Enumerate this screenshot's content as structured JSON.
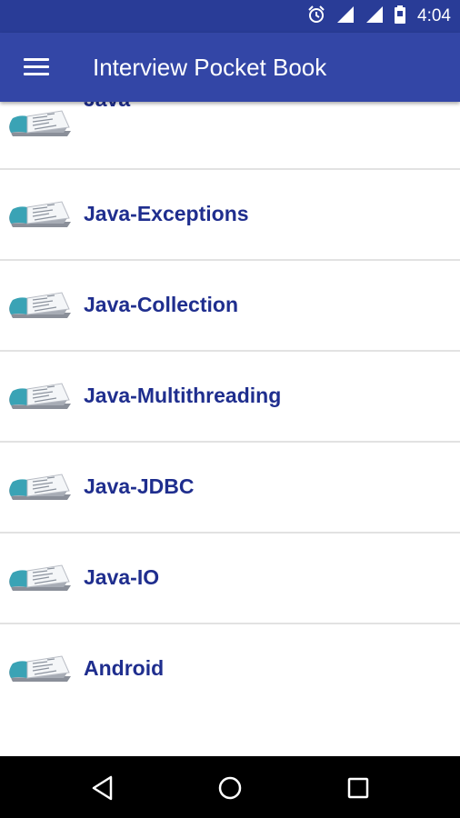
{
  "status_bar": {
    "time": "4:04",
    "icons": [
      "alarm-icon",
      "signal-icon",
      "signal-icon",
      "battery-icon"
    ]
  },
  "app_bar": {
    "menu_icon": "hamburger-menu-icon",
    "title": "Interview Pocket Book",
    "background": "#3346a6"
  },
  "topics": [
    {
      "label": "Java",
      "icon": "book-icon"
    },
    {
      "label": "Java-Exceptions",
      "icon": "book-icon"
    },
    {
      "label": "Java-Collection",
      "icon": "book-icon"
    },
    {
      "label": "Java-Multithreading",
      "icon": "book-icon"
    },
    {
      "label": "Java-JDBC",
      "icon": "book-icon"
    },
    {
      "label": "Java-IO",
      "icon": "book-icon"
    },
    {
      "label": "Android",
      "icon": "book-icon"
    }
  ],
  "navigation_bar": {
    "buttons": [
      "back-icon",
      "home-icon",
      "recents-icon"
    ]
  },
  "colors": {
    "status_bar": "#293c97",
    "app_bar": "#3346a6",
    "item_text": "#1f2e8e",
    "book_accent": "#3aa3b5",
    "divider": "#e2e2e2"
  }
}
